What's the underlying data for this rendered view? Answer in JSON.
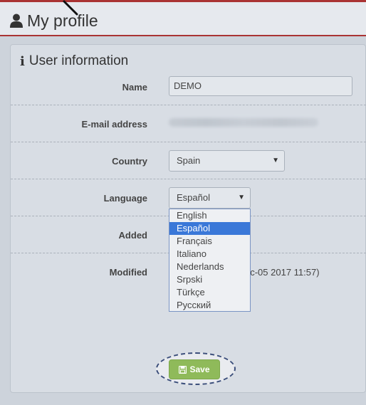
{
  "page": {
    "title": "My profile"
  },
  "card": {
    "title": "User information"
  },
  "fields": {
    "name_label": "Name",
    "name_value": "DEMO",
    "email_label": "E-mail address",
    "country_label": "Country",
    "country_value": "Spain",
    "language_label": "Language",
    "language_value": "Español",
    "added_label": "Added",
    "modified_label": "Modified",
    "modified_value_partial": "ec-05 2017 11:57)"
  },
  "language_options": [
    "English",
    "Español",
    "Français",
    "Italiano",
    "Nederlands",
    "Srpski",
    "Türkçe",
    "Русский"
  ],
  "selected_language_index": 1,
  "buttons": {
    "save_label": "Save"
  },
  "colors": {
    "accent_red": "#aa3333",
    "save_green": "#8fba5a",
    "selection_blue": "#3a78d8"
  }
}
